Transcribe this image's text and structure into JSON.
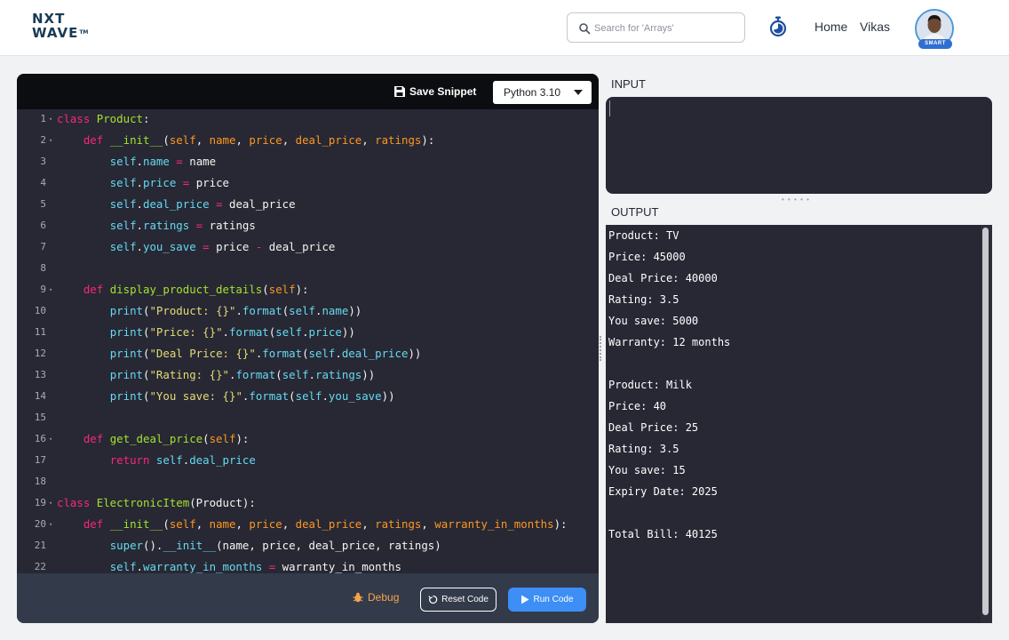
{
  "header": {
    "logo": {
      "line1": "NXT",
      "line2": "WAVE",
      "tm": "TM"
    },
    "search": {
      "placeholder": "Search for 'Arrays'"
    },
    "nav": {
      "home": "Home",
      "user": "Vikas"
    },
    "avatar_badge": "SMART",
    "icons": {
      "search": "search-icon",
      "timer": "stopwatch-icon"
    }
  },
  "editor": {
    "save_label": "Save Snippet",
    "language": "Python 3.10",
    "debug_label": "Debug",
    "reset_label": "Reset Code",
    "run_label": "Run Code",
    "lines": [
      {
        "n": "1",
        "fold": true,
        "tokens": [
          [
            "kw",
            "class "
          ],
          [
            "cls",
            "Product"
          ],
          [
            "pl",
            ":"
          ]
        ]
      },
      {
        "n": "2",
        "fold": true,
        "tokens": [
          [
            "pl",
            "    "
          ],
          [
            "kw",
            "def "
          ],
          [
            "fn",
            "__init__"
          ],
          [
            "pl",
            "("
          ],
          [
            "prm",
            "self"
          ],
          [
            "pl",
            ", "
          ],
          [
            "prm",
            "name"
          ],
          [
            "pl",
            ", "
          ],
          [
            "prm",
            "price"
          ],
          [
            "pl",
            ", "
          ],
          [
            "prm",
            "deal_price"
          ],
          [
            "pl",
            ", "
          ],
          [
            "prm",
            "ratings"
          ],
          [
            "pl",
            "):"
          ]
        ]
      },
      {
        "n": "3",
        "tokens": [
          [
            "pl",
            "        "
          ],
          [
            "sl",
            "self"
          ],
          [
            "pl",
            "."
          ],
          [
            "sl",
            "name"
          ],
          [
            "op",
            " = "
          ],
          [
            "pl",
            "name"
          ]
        ]
      },
      {
        "n": "4",
        "tokens": [
          [
            "pl",
            "        "
          ],
          [
            "sl",
            "self"
          ],
          [
            "pl",
            "."
          ],
          [
            "sl",
            "price"
          ],
          [
            "op",
            " = "
          ],
          [
            "pl",
            "price"
          ]
        ]
      },
      {
        "n": "5",
        "tokens": [
          [
            "pl",
            "        "
          ],
          [
            "sl",
            "self"
          ],
          [
            "pl",
            "."
          ],
          [
            "sl",
            "deal_price"
          ],
          [
            "op",
            " = "
          ],
          [
            "pl",
            "deal_price"
          ]
        ]
      },
      {
        "n": "6",
        "tokens": [
          [
            "pl",
            "        "
          ],
          [
            "sl",
            "self"
          ],
          [
            "pl",
            "."
          ],
          [
            "sl",
            "ratings"
          ],
          [
            "op",
            " = "
          ],
          [
            "pl",
            "ratings"
          ]
        ]
      },
      {
        "n": "7",
        "tokens": [
          [
            "pl",
            "        "
          ],
          [
            "sl",
            "self"
          ],
          [
            "pl",
            "."
          ],
          [
            "sl",
            "you_save"
          ],
          [
            "op",
            " = "
          ],
          [
            "pl",
            "price "
          ],
          [
            "op",
            "-"
          ],
          [
            "pl",
            " deal_price"
          ]
        ]
      },
      {
        "n": "8",
        "tokens": []
      },
      {
        "n": "9",
        "fold": true,
        "tokens": [
          [
            "pl",
            "    "
          ],
          [
            "kw",
            "def "
          ],
          [
            "fn",
            "display_product_details"
          ],
          [
            "pl",
            "("
          ],
          [
            "prm",
            "self"
          ],
          [
            "pl",
            "):"
          ]
        ]
      },
      {
        "n": "10",
        "tokens": [
          [
            "pl",
            "        "
          ],
          [
            "bi",
            "print"
          ],
          [
            "pl",
            "("
          ],
          [
            "str",
            "\"Product: {}\""
          ],
          [
            "pl",
            "."
          ],
          [
            "bi",
            "format"
          ],
          [
            "pl",
            "("
          ],
          [
            "sl",
            "self"
          ],
          [
            "pl",
            "."
          ],
          [
            "sl",
            "name"
          ],
          [
            "pl",
            "))"
          ]
        ]
      },
      {
        "n": "11",
        "tokens": [
          [
            "pl",
            "        "
          ],
          [
            "bi",
            "print"
          ],
          [
            "pl",
            "("
          ],
          [
            "str",
            "\"Price: {}\""
          ],
          [
            "pl",
            "."
          ],
          [
            "bi",
            "format"
          ],
          [
            "pl",
            "("
          ],
          [
            "sl",
            "self"
          ],
          [
            "pl",
            "."
          ],
          [
            "sl",
            "price"
          ],
          [
            "pl",
            "))"
          ]
        ]
      },
      {
        "n": "12",
        "tokens": [
          [
            "pl",
            "        "
          ],
          [
            "bi",
            "print"
          ],
          [
            "pl",
            "("
          ],
          [
            "str",
            "\"Deal Price: {}\""
          ],
          [
            "pl",
            "."
          ],
          [
            "bi",
            "format"
          ],
          [
            "pl",
            "("
          ],
          [
            "sl",
            "self"
          ],
          [
            "pl",
            "."
          ],
          [
            "sl",
            "deal_price"
          ],
          [
            "pl",
            "))"
          ]
        ]
      },
      {
        "n": "13",
        "tokens": [
          [
            "pl",
            "        "
          ],
          [
            "bi",
            "print"
          ],
          [
            "pl",
            "("
          ],
          [
            "str",
            "\"Rating: {}\""
          ],
          [
            "pl",
            "."
          ],
          [
            "bi",
            "format"
          ],
          [
            "pl",
            "("
          ],
          [
            "sl",
            "self"
          ],
          [
            "pl",
            "."
          ],
          [
            "sl",
            "ratings"
          ],
          [
            "pl",
            "))"
          ]
        ]
      },
      {
        "n": "14",
        "tokens": [
          [
            "pl",
            "        "
          ],
          [
            "bi",
            "print"
          ],
          [
            "pl",
            "("
          ],
          [
            "str",
            "\"You save: {}\""
          ],
          [
            "pl",
            "."
          ],
          [
            "bi",
            "format"
          ],
          [
            "pl",
            "("
          ],
          [
            "sl",
            "self"
          ],
          [
            "pl",
            "."
          ],
          [
            "sl",
            "you_save"
          ],
          [
            "pl",
            "))"
          ]
        ]
      },
      {
        "n": "15",
        "tokens": []
      },
      {
        "n": "16",
        "fold": true,
        "tokens": [
          [
            "pl",
            "    "
          ],
          [
            "kw",
            "def "
          ],
          [
            "fn",
            "get_deal_price"
          ],
          [
            "pl",
            "("
          ],
          [
            "prm",
            "self"
          ],
          [
            "pl",
            "):"
          ]
        ]
      },
      {
        "n": "17",
        "tokens": [
          [
            "pl",
            "        "
          ],
          [
            "kw",
            "return "
          ],
          [
            "sl",
            "self"
          ],
          [
            "pl",
            "."
          ],
          [
            "sl",
            "deal_price"
          ]
        ]
      },
      {
        "n": "18",
        "tokens": []
      },
      {
        "n": "19",
        "fold": true,
        "tokens": [
          [
            "kw",
            "class "
          ],
          [
            "cls",
            "ElectronicItem"
          ],
          [
            "pl",
            "(Product):"
          ]
        ]
      },
      {
        "n": "20",
        "fold": true,
        "tokens": [
          [
            "pl",
            "    "
          ],
          [
            "kw",
            "def "
          ],
          [
            "fn",
            "__init__"
          ],
          [
            "pl",
            "("
          ],
          [
            "prm",
            "self"
          ],
          [
            "pl",
            ", "
          ],
          [
            "prm",
            "name"
          ],
          [
            "pl",
            ", "
          ],
          [
            "prm",
            "price"
          ],
          [
            "pl",
            ", "
          ],
          [
            "prm",
            "deal_price"
          ],
          [
            "pl",
            ", "
          ],
          [
            "prm",
            "ratings"
          ],
          [
            "pl",
            ", "
          ],
          [
            "prm",
            "warranty_in_months"
          ],
          [
            "pl",
            "):"
          ]
        ]
      },
      {
        "n": "21",
        "tokens": [
          [
            "pl",
            "        "
          ],
          [
            "bi",
            "super"
          ],
          [
            "pl",
            "()."
          ],
          [
            "bi",
            "__init__"
          ],
          [
            "pl",
            "(name, price, deal_price, ratings)"
          ]
        ]
      },
      {
        "n": "22",
        "tokens": [
          [
            "pl",
            "        "
          ],
          [
            "sl",
            "self"
          ],
          [
            "pl",
            "."
          ],
          [
            "sl",
            "warranty_in_months"
          ],
          [
            "op",
            " = "
          ],
          [
            "pl",
            "warranty_in_months"
          ]
        ]
      }
    ]
  },
  "input_panel": {
    "label": "INPUT",
    "value": ""
  },
  "output_panel": {
    "label": "OUTPUT",
    "lines": [
      "Product: TV",
      "Price: 45000",
      "Deal Price: 40000",
      "Rating: 3.5",
      "You save: 5000",
      "Warranty: 12 months",
      "",
      "Product: Milk",
      "Price: 40",
      "Deal Price: 25",
      "Rating: 3.5",
      "You save: 15",
      "Expiry Date: 2025",
      "",
      "Total Bill: 40125"
    ]
  },
  "colors": {
    "editor_bg": "#272834",
    "run_button": "#3d8ef5",
    "debug": "#f6a44d",
    "keyword": "#f9267e",
    "class_name": "#a6e22e",
    "param": "#fd9720",
    "builtin": "#66d9ef",
    "string": "#e6db74"
  }
}
